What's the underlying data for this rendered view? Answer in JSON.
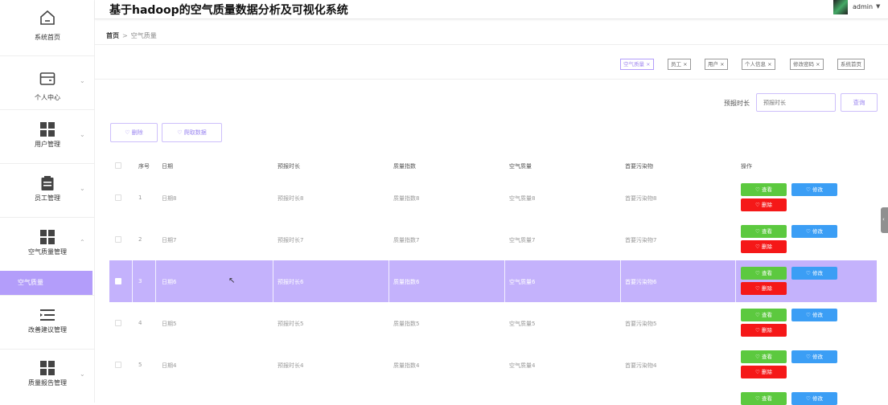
{
  "app_title": "基于hadoop的空气质量数据分析及可视化系统",
  "user": {
    "name": "admin"
  },
  "sidebar": {
    "items": [
      {
        "label": "系统首页",
        "icon": "home-icon"
      },
      {
        "label": "个人中心",
        "icon": "wallet-icon"
      },
      {
        "label": "用户管理",
        "icon": "grid-icon"
      },
      {
        "label": "员工管理",
        "icon": "clipboard-icon"
      },
      {
        "label": "空气质量管理",
        "icon": "grid-icon"
      },
      {
        "label": "改善建议管理",
        "icon": "menu-icon"
      },
      {
        "label": "质量报告管理",
        "icon": "grid-icon"
      }
    ],
    "sub_active": "空气质量"
  },
  "breadcrumb": {
    "home": "首页",
    "sep": ">",
    "current": "空气质量"
  },
  "tags": [
    {
      "label": "空气质量",
      "active": true
    },
    {
      "label": "员工",
      "active": false
    },
    {
      "label": "用户",
      "active": false
    },
    {
      "label": "个人信息",
      "active": false
    },
    {
      "label": "修改密码",
      "active": false
    },
    {
      "label": "系统首页",
      "active": false
    }
  ],
  "search": {
    "label": "预报时长",
    "placeholder": "预报时长",
    "button": "查询"
  },
  "toolbar": {
    "delete": "删除",
    "crawl": "爬取数据"
  },
  "table": {
    "headers": [
      "序号",
      "日期",
      "预报时长",
      "质量指数",
      "空气质量",
      "首要污染物",
      "操作"
    ],
    "rows": [
      [
        "1",
        "日期8",
        "预报时长8",
        "质量指数8",
        "空气质量8",
        "首要污染物8"
      ],
      [
        "2",
        "日期7",
        "预报时长7",
        "质量指数7",
        "空气质量7",
        "首要污染物7"
      ],
      [
        "3",
        "日期6",
        "预报时长6",
        "质量指数6",
        "空气质量6",
        "首要污染物6"
      ],
      [
        "4",
        "日期5",
        "预报时长5",
        "质量指数5",
        "空气质量5",
        "首要污染物5"
      ],
      [
        "5",
        "日期4",
        "预报时长4",
        "质量指数4",
        "空气质量4",
        "首要污染物4"
      ]
    ],
    "actions": {
      "view": "查看",
      "edit": "修改",
      "delete": "删除"
    }
  },
  "colors": {
    "accent": "#b39dfa",
    "view": "#5cc93f",
    "edit": "#3b9ef5",
    "delete": "#f51818"
  }
}
